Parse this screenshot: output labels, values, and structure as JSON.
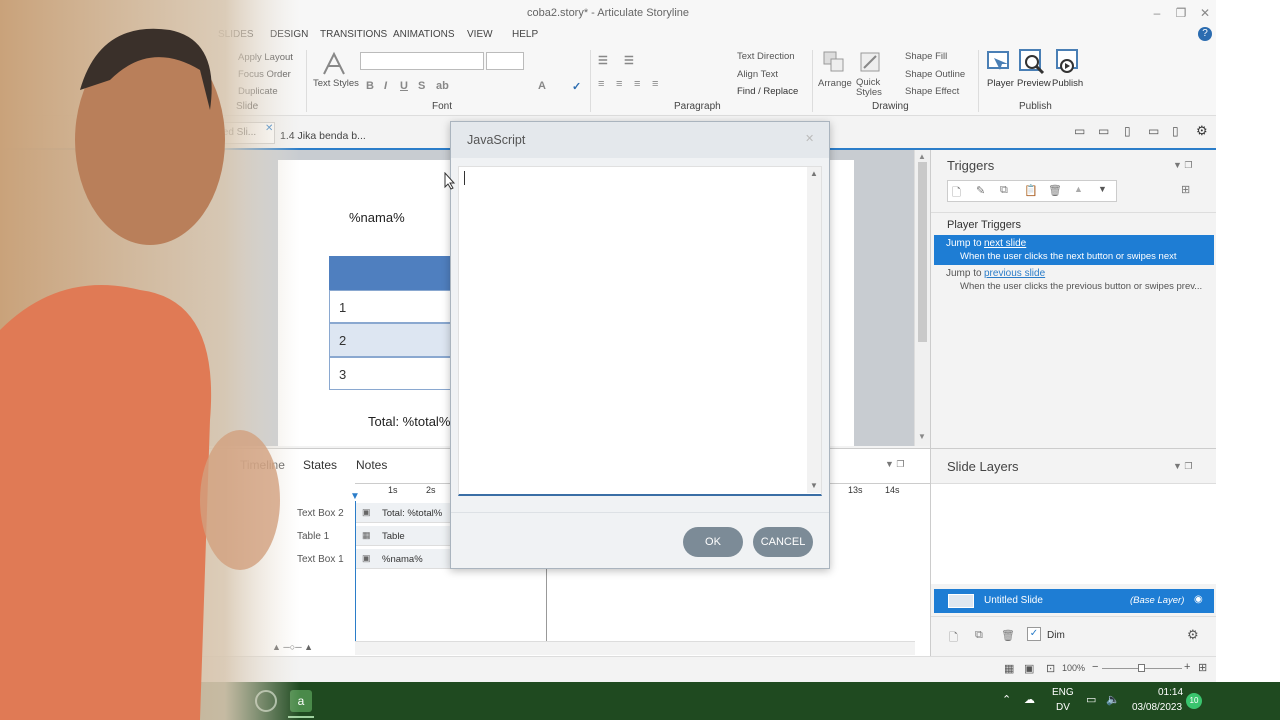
{
  "window": {
    "title": "coba2.story* - Articulate Storyline"
  },
  "ribbon_tabs": [
    "SLIDES",
    "DESIGN",
    "TRANSITIONS",
    "ANIMATIONS",
    "VIEW",
    "HELP"
  ],
  "slide_group": {
    "apply_layout": "Apply Layout",
    "focus_order": "Focus Order",
    "duplicate": "Duplicate",
    "label": "Slide"
  },
  "font_group": {
    "text_styles": "Text Styles",
    "label": "Font"
  },
  "paragraph_group": {
    "text_direction": "Text Direction",
    "align_text": "Align Text",
    "find_replace": "Find / Replace",
    "label": "Paragraph"
  },
  "drawing_group": {
    "arrange": "Arrange",
    "quick_styles": "Quick Styles",
    "shape_fill": "Shape Fill",
    "shape_outline": "Shape Outline",
    "shape_effect": "Shape Effect",
    "label": "Drawing"
  },
  "publish_group": {
    "player": "Player",
    "preview": "Preview",
    "publish": "Publish",
    "label": "Publish"
  },
  "doc_tabs": [
    "Untitled Sli...",
    "1.4 Jika benda b..."
  ],
  "slide": {
    "name_var": "%nama%",
    "table_rows": [
      "1",
      "2",
      "3"
    ],
    "total_var": "Total: %total%"
  },
  "timeline": {
    "tabs": [
      "Timeline",
      "States",
      "Notes"
    ],
    "ticks": [
      "1s",
      "2s",
      "13s",
      "14s"
    ],
    "rows": [
      {
        "name": "Text Box 2",
        "label": "Total: %total%"
      },
      {
        "name": "Table 1",
        "label": "Table"
      },
      {
        "name": "Text Box 1",
        "label": "%nama%"
      }
    ]
  },
  "dialog": {
    "title": "JavaScript",
    "code": "",
    "ok": "OK",
    "cancel": "CANCEL"
  },
  "triggers": {
    "title": "Triggers",
    "section": "Player Triggers",
    "items": [
      {
        "action": "Jump to",
        "target": "next slide",
        "when": "When the user clicks the next button or swipes next"
      },
      {
        "action": "Jump to",
        "target": "previous slide",
        "when": "When the user clicks the previous button or swipes prev..."
      }
    ]
  },
  "layers": {
    "title": "Slide Layers",
    "base": "Untitled Slide",
    "base_tag": "(Base Layer)",
    "dim": "Dim"
  },
  "status": {
    "zoom": "100%"
  },
  "taskbar": {
    "lang1": "ENG",
    "lang2": "DV",
    "time": "01:14",
    "date": "03/08/2023",
    "badge": "10"
  },
  "colors": {
    "accent": "#2b7dc9",
    "selected": "#1e7dd4",
    "table_header": "#4f7fbf",
    "taskbar": "#1f4a20"
  }
}
